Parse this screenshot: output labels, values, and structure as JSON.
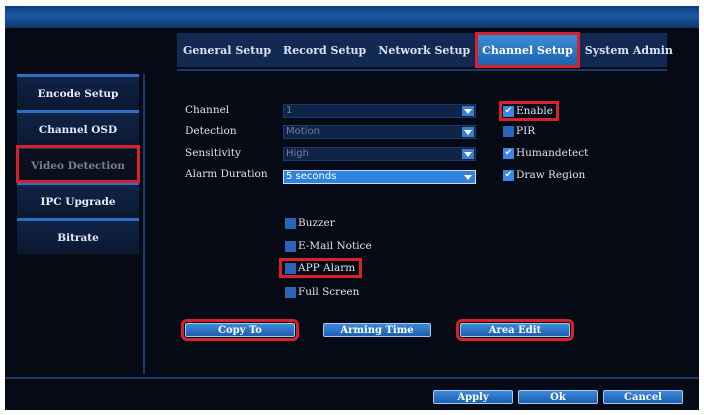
{
  "tabs": [
    {
      "label": "General Setup"
    },
    {
      "label": "Record Setup"
    },
    {
      "label": "Network Setup"
    },
    {
      "label": "Channel Setup"
    },
    {
      "label": "System Admin"
    }
  ],
  "side_menu": [
    {
      "label": "Encode Setup"
    },
    {
      "label": "Channel OSD"
    },
    {
      "label": "Video Detection"
    },
    {
      "label": "IPC Upgrade"
    },
    {
      "label": "Bitrate"
    }
  ],
  "form": {
    "channel": {
      "label": "Channel",
      "value": "1"
    },
    "detection": {
      "label": "Detection",
      "value": "Motion"
    },
    "sensitivity": {
      "label": "Sensitivity",
      "value": "High"
    },
    "alarm_duration": {
      "label": "Alarm Duration",
      "value": "5 seconds"
    }
  },
  "options": {
    "enable": {
      "label": "Enable",
      "checked": true
    },
    "pir": {
      "label": "PIR",
      "checked": false
    },
    "humandetect": {
      "label": "Humandetect",
      "checked": true
    },
    "draw_region": {
      "label": "Draw Region",
      "checked": true
    }
  },
  "actions": {
    "buzzer": {
      "label": "Buzzer",
      "checked": false
    },
    "email_notice": {
      "label": "E-Mail Notice",
      "checked": false
    },
    "app_alarm": {
      "label": "APP Alarm",
      "checked": false
    },
    "full_screen": {
      "label": "Full Screen",
      "checked": false
    }
  },
  "buttons": {
    "copy_to": "Copy To",
    "arming_time": "Arming Time",
    "area_edit": "Area Edit",
    "apply": "Apply",
    "ok": "Ok",
    "cancel": "Cancel"
  },
  "colors": {
    "highlight": "#d8222b",
    "accent": "#2c84e0"
  }
}
